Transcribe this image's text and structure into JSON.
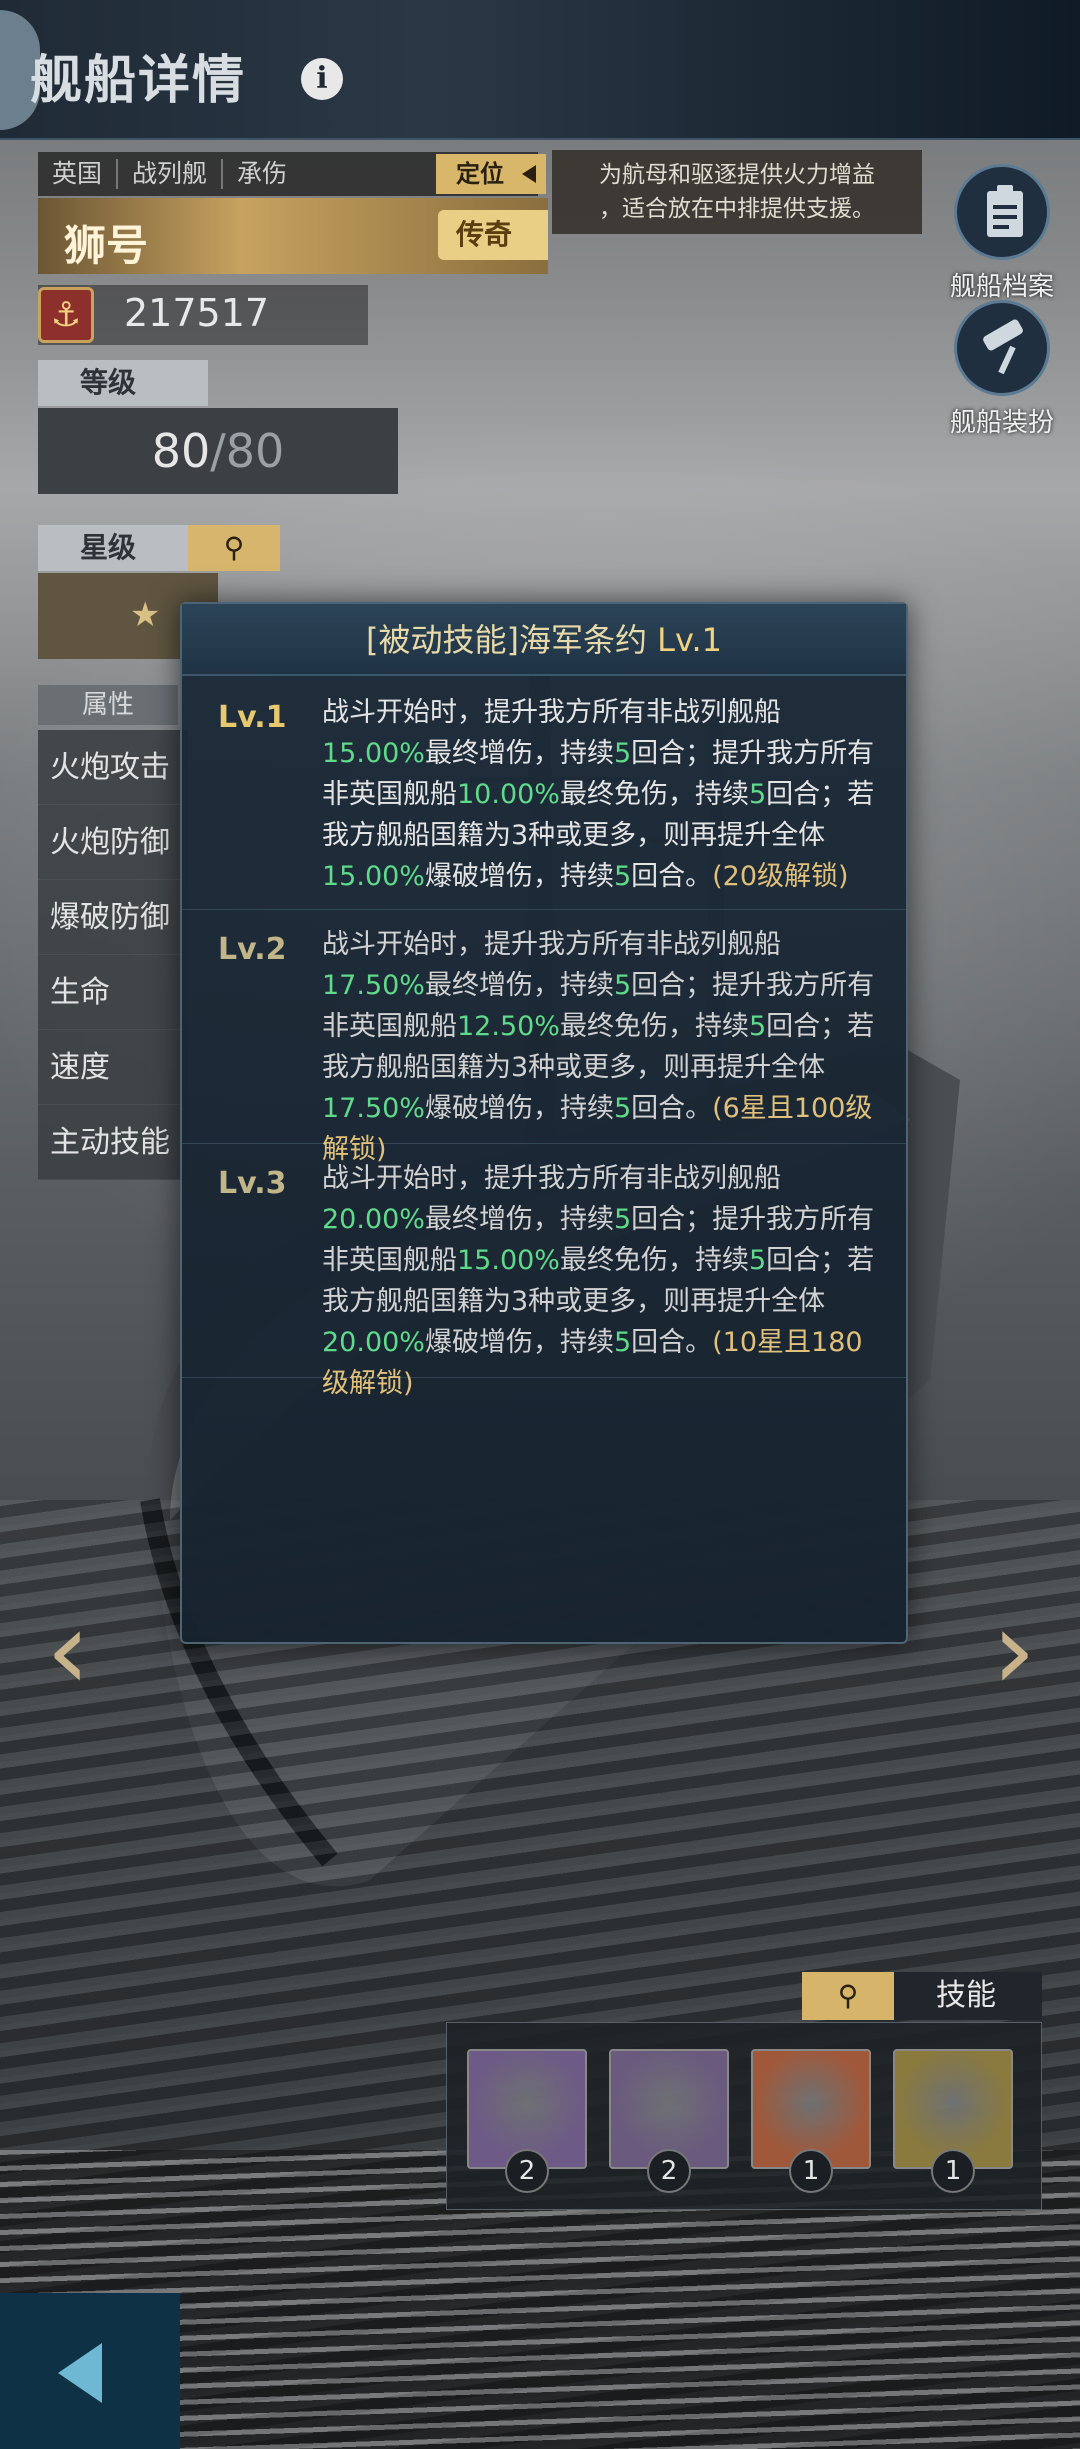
{
  "header": {
    "title": "舰船详情",
    "info_icon": "info-icon"
  },
  "ship": {
    "tags": [
      "英国",
      "战列舰",
      "承伤"
    ],
    "position_label": "定位",
    "position_desc_line1": "为航母和驱逐提供火力增益",
    "position_desc_line2": "，适合放在中排提供支援。",
    "name": "狮号",
    "rarity": "传奇",
    "power": "217517",
    "level_label": "等级",
    "level_current": "80",
    "level_max": "/80",
    "star_label": "星级",
    "star_glyph": "★",
    "attr_label": "属性",
    "attributes": [
      "火炮攻击",
      "火炮防御",
      "爆破防御",
      "生命",
      "速度",
      "主动技能"
    ]
  },
  "side_buttons": [
    {
      "label": "舰船档案",
      "icon": "clipboard-icon"
    },
    {
      "label": "舰船装扮",
      "icon": "paint-roller-icon"
    }
  ],
  "popup": {
    "title_prefix": "[被动技能]海军条约 ",
    "title_level": "Lv.1",
    "levels": [
      {
        "tag": "Lv.1",
        "tag_color": "#e7c86e",
        "segments": [
          {
            "t": "战斗开始时，提升我方所有非战列舰船",
            "c": ""
          },
          {
            "t": "15.00%",
            "c": "g"
          },
          {
            "t": "最终增伤，持续",
            "c": ""
          },
          {
            "t": "5",
            "c": "g"
          },
          {
            "t": "回合；提升我方所有非英国舰船",
            "c": ""
          },
          {
            "t": "10.00%",
            "c": "g"
          },
          {
            "t": "最终免伤，持续",
            "c": ""
          },
          {
            "t": "5",
            "c": "g"
          },
          {
            "t": "回合；若我方舰船国籍为3种或更多，则再提升全体",
            "c": ""
          },
          {
            "t": "15.00%",
            "c": "g"
          },
          {
            "t": "爆破增伤，持续",
            "c": ""
          },
          {
            "t": "5",
            "c": "g"
          },
          {
            "t": "回合。",
            "c": ""
          },
          {
            "t": "(20级解锁)",
            "c": "unlock"
          }
        ]
      },
      {
        "tag": "Lv.2",
        "tag_color": "#c2b58a",
        "segments": [
          {
            "t": "战斗开始时，提升我方所有非战列舰船",
            "c": "dim"
          },
          {
            "t": "17.50%",
            "c": "g"
          },
          {
            "t": "最终增伤，持续",
            "c": "dim"
          },
          {
            "t": "5",
            "c": "g"
          },
          {
            "t": "回合；提升我方所有非英国舰船",
            "c": "dim"
          },
          {
            "t": "12.50%",
            "c": "g"
          },
          {
            "t": "最终免伤，持续",
            "c": "dim"
          },
          {
            "t": "5",
            "c": "g"
          },
          {
            "t": "回合；若我方舰船国籍为3种或更多，则再提升全体",
            "c": "dim"
          },
          {
            "t": "17.50%",
            "c": "g"
          },
          {
            "t": "爆破增伤，持续",
            "c": "dim"
          },
          {
            "t": "5",
            "c": "g"
          },
          {
            "t": "回合。",
            "c": "dim"
          },
          {
            "t": "(6星且100级解锁)",
            "c": "unlock"
          }
        ]
      },
      {
        "tag": "Lv.3",
        "tag_color": "#c2b58a",
        "segments": [
          {
            "t": "战斗开始时，提升我方所有非战列舰船",
            "c": "dim"
          },
          {
            "t": "20.00%",
            "c": "g"
          },
          {
            "t": "最终增伤，持续",
            "c": "dim"
          },
          {
            "t": "5",
            "c": "g"
          },
          {
            "t": "回合；提升我方所有非英国舰船",
            "c": "dim"
          },
          {
            "t": "15.00%",
            "c": "g"
          },
          {
            "t": "最终免伤，持续",
            "c": "dim"
          },
          {
            "t": "5",
            "c": "g"
          },
          {
            "t": "回合；若我方舰船国籍为3种或更多，则再提升全体",
            "c": "dim"
          },
          {
            "t": "20.00%",
            "c": "g"
          },
          {
            "t": "爆破增伤，持续",
            "c": "dim"
          },
          {
            "t": "5",
            "c": "g"
          },
          {
            "t": "回合。",
            "c": "dim"
          },
          {
            "t": "(10星且180级解锁)",
            "c": "unlock"
          }
        ]
      }
    ]
  },
  "skills": {
    "label": "技能",
    "icons": [
      {
        "name": "gun-turret-skill-icon",
        "level": "2",
        "bg": "#6d5a86"
      },
      {
        "name": "battleship-skill-icon",
        "level": "2",
        "bg": "#6a5a7e"
      },
      {
        "name": "handshake-skill-icon",
        "level": "1",
        "bg": "#a0583a"
      },
      {
        "name": "explosion-skill-icon",
        "level": "1",
        "bg": "#8a7a3e"
      }
    ]
  },
  "colors": {
    "accent_gold": "#d9b76a",
    "green_value": "#5fd98a"
  }
}
